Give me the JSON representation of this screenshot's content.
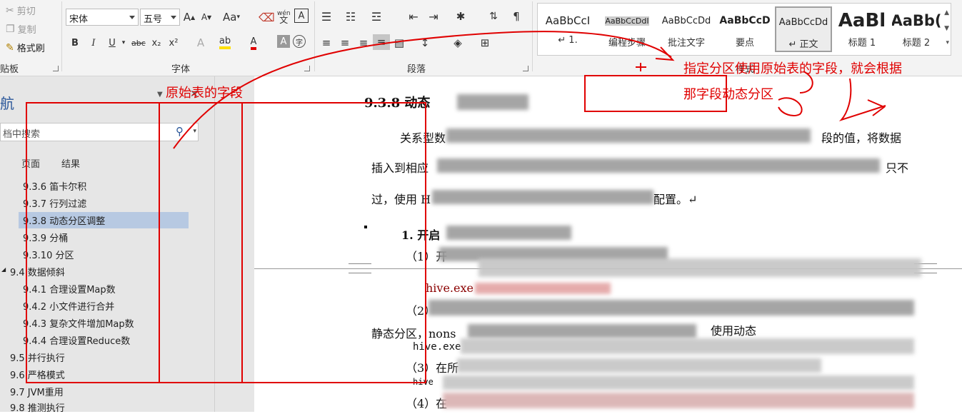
{
  "clipboard": {
    "cut": "剪切",
    "copy": "复制",
    "format_painter": "格式刷",
    "group_label": "贴板"
  },
  "font": {
    "name": "宋体",
    "size": "五号",
    "grow": "A",
    "shrink": "A",
    "change_case": "Aa",
    "phonetic": "wén",
    "bold": "B",
    "italic": "I",
    "underline": "U",
    "strike": "abc",
    "subscript": "x₂",
    "superscript": "x²",
    "color_a": "A",
    "shading_a": "A",
    "group_label": "字体"
  },
  "paragraph": {
    "group_label": "段落"
  },
  "styles": {
    "items": [
      {
        "preview": "AaBbCcI",
        "name": "↵ 1."
      },
      {
        "preview": "AaBbCcDdI",
        "name": "编程步骤"
      },
      {
        "preview": "AaBbCcDd",
        "name": "批注文字"
      },
      {
        "preview": "AaBbCcD",
        "name": "要点"
      },
      {
        "preview": "AaBbCcDd",
        "name": "↵ 正文"
      },
      {
        "preview": "AaBl",
        "name": "标题 1"
      },
      {
        "preview": "AaBb(",
        "name": "标题 2"
      }
    ],
    "group_label": "样式"
  },
  "nav": {
    "title": "航",
    "search_placeholder": "档中搜索",
    "tabs": [
      "页面",
      "结果"
    ],
    "items": [
      {
        "label": "9.3.6 笛卡尔积",
        "level": 2
      },
      {
        "label": "9.3.7 行列过滤",
        "level": 2
      },
      {
        "label": "9.3.8 动态分区调整",
        "level": 2,
        "selected": true
      },
      {
        "label": "9.3.9 分桶",
        "level": 2
      },
      {
        "label": "9.3.10 分区",
        "level": 2
      },
      {
        "label": "9.4 数据倾斜",
        "level": 1,
        "expanded": true
      },
      {
        "label": "9.4.1 合理设置Map数",
        "level": 2
      },
      {
        "label": "9.4.2 小文件进行合并",
        "level": 2
      },
      {
        "label": "9.4.3 复杂文件增加Map数",
        "level": 2
      },
      {
        "label": "9.4.4 合理设置Reduce数",
        "level": 2
      },
      {
        "label": "9.5 并行执行",
        "level": 1
      },
      {
        "label": "9.6 严格模式",
        "level": 1
      },
      {
        "label": "9.7 JVM重用",
        "level": 1
      },
      {
        "label": "9.8 推测执行",
        "level": 1
      }
    ]
  },
  "doc": {
    "heading": "9.3.8 动态",
    "line1_start": "关系型数",
    "line1_end": "段的值，将数据",
    "line2_start": "插入到相应",
    "line2_end": "只不",
    "line3_start": "过，使用 H",
    "line3_end": "配置。↵",
    "sub1": "1. 开启",
    "item1": "（1）开",
    "code1": "hive.exe",
    "item2": "（2）",
    "static_label": "静态分区，nons",
    "static_mid": "使用动态",
    "code2": "hive.exe",
    "item3": "（3）在所",
    "code3": "hive",
    "item4": "（4）在"
  },
  "annotations": {
    "source_field": "原始表的字段",
    "partition_note_line1": "指定分区使用原始表的字段，就会根据",
    "partition_note_line2": "那字段动态分区"
  },
  "colors": {
    "annotation": "#e00000",
    "accent": "#2b579a",
    "selected_nav": "#b7c9e2"
  }
}
